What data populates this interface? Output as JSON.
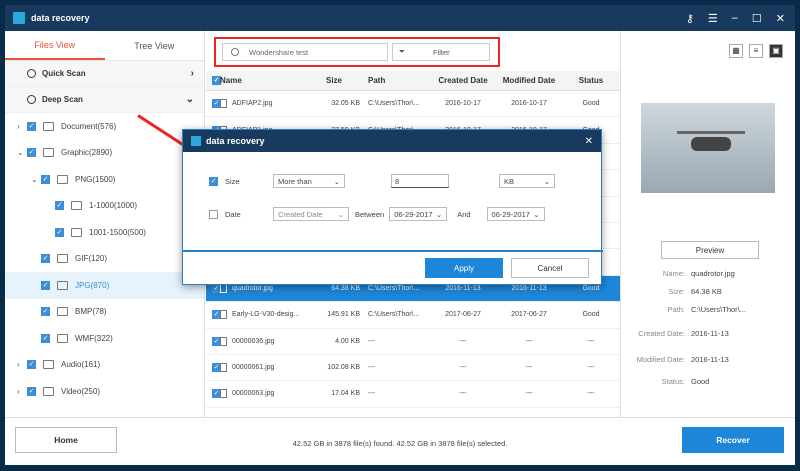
{
  "window": {
    "title": "data recovery"
  },
  "sidebar": {
    "tabs": [
      "Files View",
      "Tree View"
    ],
    "scans": [
      "Quick Scan",
      "Deep Scan"
    ],
    "tree": [
      {
        "label": "Document(576)",
        "level": 0,
        "arrow": "›",
        "checked": true
      },
      {
        "label": "Graphic(2890)",
        "level": 0,
        "arrow": "⌄",
        "checked": true
      },
      {
        "label": "PNG(1500)",
        "level": 1,
        "arrow": "⌄",
        "checked": true
      },
      {
        "label": "1-1000(1000)",
        "level": 2,
        "arrow": "",
        "checked": true
      },
      {
        "label": "1001-1500(500)",
        "level": 2,
        "arrow": "",
        "checked": true
      },
      {
        "label": "GIF(120)",
        "level": 1,
        "arrow": "",
        "checked": true
      },
      {
        "label": "JPG(870)",
        "level": 1,
        "arrow": "",
        "checked": true,
        "selected": true
      },
      {
        "label": "BMP(78)",
        "level": 1,
        "arrow": "",
        "checked": true
      },
      {
        "label": "WMF(322)",
        "level": 1,
        "arrow": "",
        "checked": true
      },
      {
        "label": "Audio(161)",
        "level": 0,
        "arrow": "›",
        "checked": true
      },
      {
        "label": "Video(250)",
        "level": 0,
        "arrow": "›",
        "checked": true
      }
    ]
  },
  "toolbar": {
    "search_value": "Wondershare test",
    "filter_label": "Filter"
  },
  "table": {
    "headers": [
      "Name",
      "Size",
      "Path",
      "Created Date",
      "Modified Date",
      "Status"
    ],
    "rows": [
      [
        "ADFIAP2.jpg",
        "32.05 KB",
        "C:\\Users\\Thor\\...",
        "2016-10-17",
        "2016-10-17",
        "Good"
      ],
      [
        "ADFIAP1.jpg",
        "27.50 KB",
        "C:\\Users\\Thor\\...",
        "2016-10-17",
        "2016-10-17",
        "Good"
      ],
      [
        "",
        "",
        "",
        "",
        "",
        ""
      ],
      [
        "",
        "",
        "",
        "",
        "",
        ""
      ],
      [
        "",
        "",
        "",
        "",
        "",
        ""
      ],
      [
        "",
        "",
        "",
        "",
        "",
        ""
      ],
      [
        "",
        "",
        "",
        "",
        "",
        ""
      ],
      [
        "quadrotor.jpg",
        "64.38 KB",
        "C:\\Users\\Thor\\...",
        "2016-11-13",
        "2016-11-13",
        "Good"
      ],
      [
        "Early-LG-V30-desig...",
        "145.91 KB",
        "C:\\Users\\Thor\\...",
        "2017-06-27",
        "2017-06-27",
        "Good"
      ],
      [
        "00000036.jpg",
        "4.00 KB",
        "---",
        "---",
        "---",
        "---"
      ],
      [
        "00000061.jpg",
        "102.08 KB",
        "---",
        "---",
        "---",
        "---"
      ],
      [
        "00000063.jpg",
        "17.04 KB",
        "---",
        "---",
        "---",
        "---"
      ]
    ],
    "selected_index": 7
  },
  "preview": {
    "button": "Preview",
    "info": [
      [
        "Name:",
        "quadrotor.jpg"
      ],
      [
        "Size:",
        "64.38 KB"
      ],
      [
        "Path:",
        "C:\\Users\\Thor\\..."
      ],
      [
        "Created Date:",
        "2016-11-13"
      ],
      [
        "Modified Date:",
        "2016-11-13"
      ],
      [
        "Status:",
        "Good"
      ]
    ]
  },
  "footer": {
    "home": "Home",
    "status": "42.52 GB in 3878 file(s) found.   42.52 GB in 3878 file(s) selected.",
    "recover": "Recover"
  },
  "dialog": {
    "title": "data recovery",
    "size_label": "Size",
    "size_op": "More than",
    "size_value": "8",
    "size_unit": "KB",
    "date_label": "Date",
    "date_type": "Created Date",
    "between": "Between",
    "date_from": "06-29-2017",
    "and": "And",
    "date_to": "06-29-2017",
    "apply": "Apply",
    "cancel": "Cancel"
  },
  "colors": {
    "accent": "#1e86d8",
    "titlebar": "#173a5e",
    "highlight": "#e22222"
  }
}
